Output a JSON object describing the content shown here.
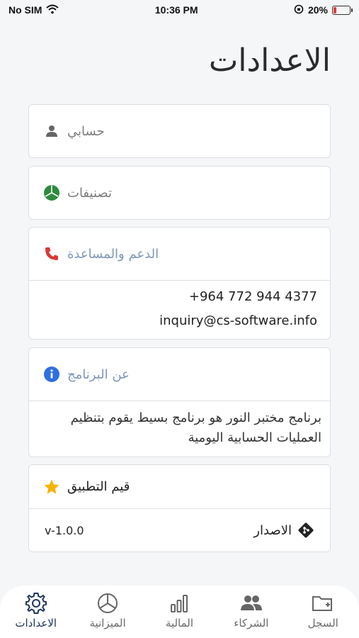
{
  "status_bar": {
    "carrier": "No SIM",
    "time": "10:36 PM",
    "battery": "20%",
    "battery_level": 0.2,
    "battery_color": "#e03b3b"
  },
  "page": {
    "title": "الاعدادات"
  },
  "account": {
    "label": "حسابي",
    "icon": "user-icon"
  },
  "categories": {
    "label": "تصنيفات",
    "icon": "pie-chart-icon",
    "icon_color": "#2e8b3e"
  },
  "support": {
    "label": "الدعم والمساعدة",
    "icon": "phone-icon",
    "icon_color": "#d93838",
    "phone": "+964 772 944 4377",
    "email": "inquiry@cs-software.info"
  },
  "about": {
    "label": "عن البرنامج",
    "icon": "info-icon",
    "icon_color": "#2f6fe0",
    "text": "برنامج مختبر النور هو برنامج بسيط يقوم بتنظيم العمليات الحسابية اليومية"
  },
  "rate": {
    "label": "قيم التطبيق",
    "icon": "star-icon",
    "icon_color": "#f5b400"
  },
  "version": {
    "label": "الاصدار",
    "value": "v-1.0.0",
    "icon": "git-diamond-icon"
  },
  "tabs": [
    {
      "label": "الاعدادات",
      "icon": "gear-icon",
      "active": true
    },
    {
      "label": "الميزانية",
      "icon": "pie-icon",
      "active": false
    },
    {
      "label": "المالية",
      "icon": "bar-chart-icon",
      "active": false
    },
    {
      "label": "الشركاء",
      "icon": "people-icon",
      "active": false
    },
    {
      "label": "السجل",
      "icon": "folder-add-icon",
      "active": false
    }
  ]
}
